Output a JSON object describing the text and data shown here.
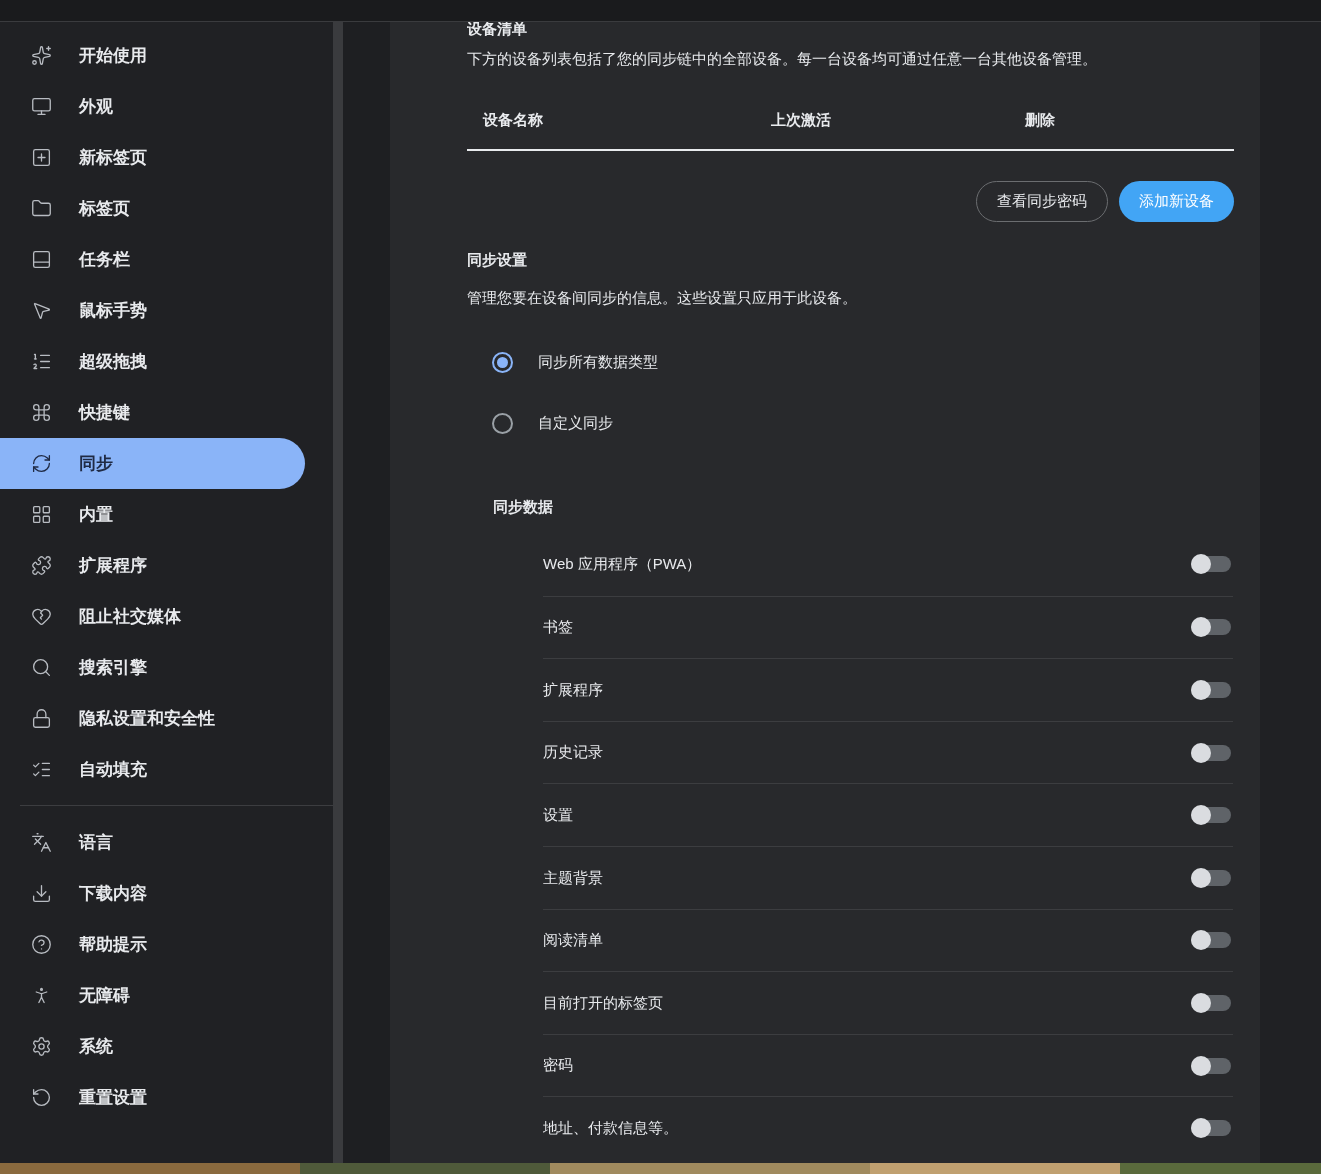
{
  "sidebar": {
    "groups": [
      [
        {
          "label": "开始使用",
          "selected": false
        },
        {
          "label": "外观",
          "selected": false
        },
        {
          "label": "新标签页",
          "selected": false
        },
        {
          "label": "标签页",
          "selected": false
        },
        {
          "label": "任务栏",
          "selected": false
        },
        {
          "label": "鼠标手势",
          "selected": false
        },
        {
          "label": "超级拖拽",
          "selected": false
        },
        {
          "label": "快捷键",
          "selected": false
        },
        {
          "label": "同步",
          "selected": true
        },
        {
          "label": "内置",
          "selected": false
        },
        {
          "label": "扩展程序",
          "selected": false
        },
        {
          "label": "阻止社交媒体",
          "selected": false
        },
        {
          "label": "搜索引擎",
          "selected": false
        },
        {
          "label": "隐私设置和安全性",
          "selected": false
        },
        {
          "label": "自动填充",
          "selected": false
        }
      ],
      [
        {
          "label": "语言",
          "selected": false
        },
        {
          "label": "下载内容",
          "selected": false
        },
        {
          "label": "帮助提示",
          "selected": false
        },
        {
          "label": "无障碍",
          "selected": false
        },
        {
          "label": "系统",
          "selected": false
        },
        {
          "label": "重置设置",
          "selected": false
        }
      ]
    ]
  },
  "devices": {
    "title": "设备清单",
    "description": "下方的设备列表包括了您的同步链中的全部设备。每一台设备均可通过任意一台其他设备管理。",
    "columns": [
      "设备名称",
      "上次激活",
      "删除"
    ],
    "buttons": [
      {
        "label": "查看同步密码",
        "kind": "outline"
      },
      {
        "label": "添加新设备",
        "kind": "primary"
      }
    ]
  },
  "sync_settings": {
    "title": "同步设置",
    "description": "管理您要在设备间同步的信息。这些设置只应用于此设备。",
    "options": [
      {
        "label": "同步所有数据类型",
        "selected": true
      },
      {
        "label": "自定义同步",
        "selected": false
      }
    ],
    "data_title": "同步数据",
    "items": [
      {
        "label": "Web 应用程序（PWA）",
        "on": false
      },
      {
        "label": "书签",
        "on": false
      },
      {
        "label": "扩展程序",
        "on": false
      },
      {
        "label": "历史记录",
        "on": false
      },
      {
        "label": "设置",
        "on": false
      },
      {
        "label": "主题背景",
        "on": false
      },
      {
        "label": "阅读清单",
        "on": false
      },
      {
        "label": "目前打开的标签页",
        "on": false
      },
      {
        "label": "密码",
        "on": false
      },
      {
        "label": "地址、付款信息等。",
        "on": false
      }
    ]
  }
}
